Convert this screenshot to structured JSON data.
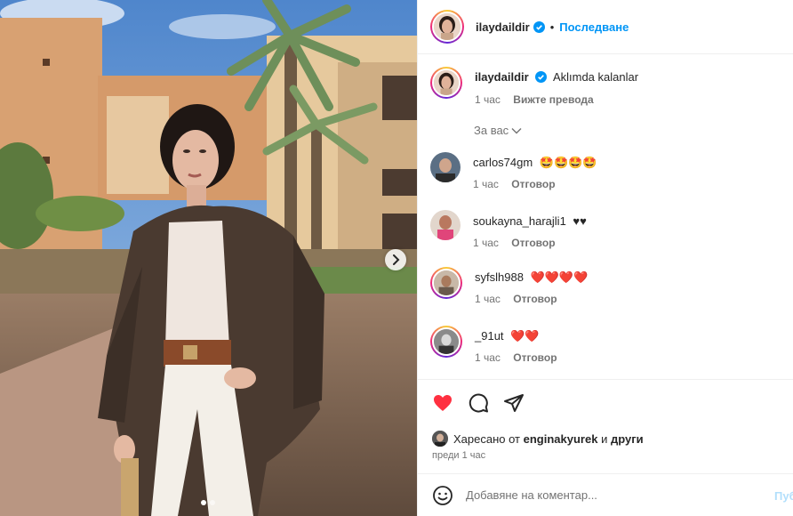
{
  "post": {
    "author": "ilaydaildir",
    "follow_label": "Последване",
    "separator": "•"
  },
  "caption": {
    "username": "ilaydaildir",
    "text": "Aklımda kalanlar",
    "time": "1 час",
    "translate_label": "Вижте превода"
  },
  "filter_label": "За вас",
  "comments": [
    {
      "username": "carlos74gm",
      "text": "🤩🤩🤩🤩",
      "time": "1 час",
      "reply_label": "Отговор"
    },
    {
      "username": "soukayna_harajli1",
      "text": "♥♥",
      "time": "1 час",
      "reply_label": "Отговор"
    },
    {
      "username": "syfslh988",
      "text": "❤️❤️❤️❤️",
      "time": "1 час",
      "reply_label": "Отговор"
    },
    {
      "username": "_91ut",
      "text": "❤️❤️",
      "time": "1 час",
      "reply_label": "Отговор"
    }
  ],
  "likes": {
    "prefix": "Харесано от",
    "user": "enginakyurek",
    "conjunction": "и",
    "others": "други"
  },
  "posted_ago": "преди 1 час",
  "add_comment": {
    "placeholder": "Добавяне на коментар...",
    "post_label": "Пуб"
  },
  "carousel": {
    "slides": 2,
    "active_slide": 1
  },
  "colors": {
    "accent": "#0095f6",
    "like_red": "#ff3040",
    "muted": "#737373"
  },
  "icons": [
    "emoji-icon",
    "heart-icon",
    "comment-icon",
    "share-icon",
    "verified-icon",
    "chevron-right-icon",
    "chevron-down-icon"
  ]
}
